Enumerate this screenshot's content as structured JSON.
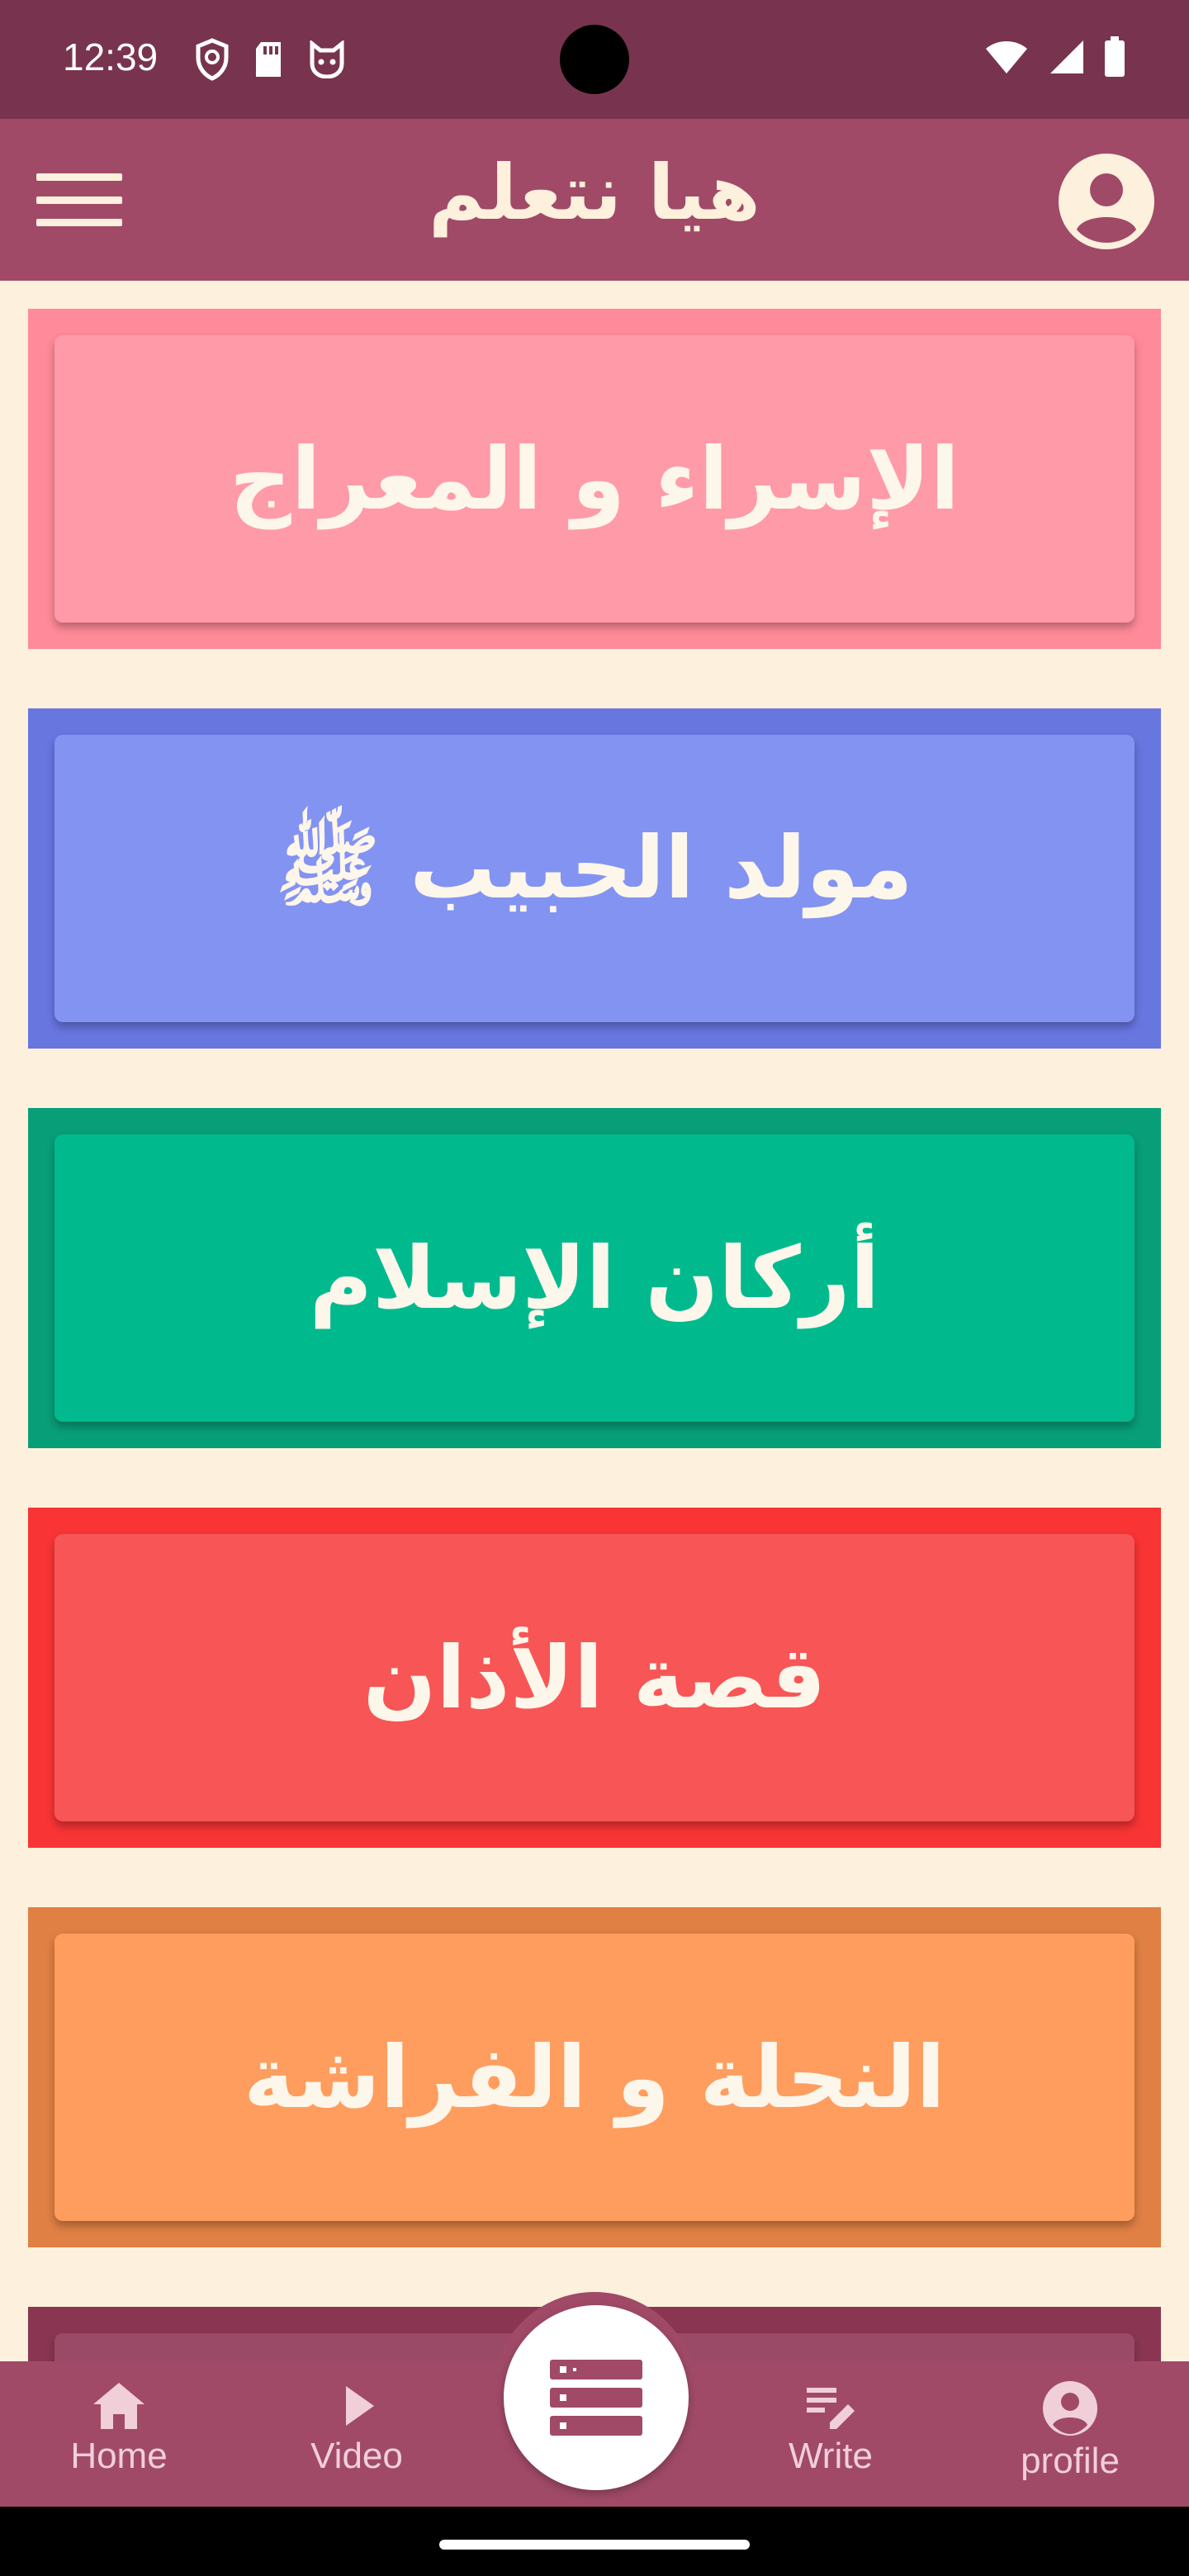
{
  "status_bar": {
    "time": "12:39",
    "left_icons": [
      "shield-icon",
      "sd-card-icon",
      "cat-icon"
    ],
    "right_icons": [
      "wifi-icon",
      "signal-icon",
      "battery-icon"
    ]
  },
  "app_bar": {
    "title": "هيا نتعلم",
    "menu_icon": "hamburger-menu-icon",
    "profile_icon": "account-circle-icon"
  },
  "cards": [
    {
      "label": "الإسراء و المعراج",
      "outer_color": "#ff8a99",
      "inner_color": "#ff9aa8"
    },
    {
      "label": "مولد الحبيب ﷺ",
      "outer_color": "#6876e0",
      "inner_color": "#8393f2"
    },
    {
      "label": "أركان الإسلام",
      "outer_color": "#089e78",
      "inner_color": "#00ba8e"
    },
    {
      "label": "قصة الأذان",
      "outer_color": "#f83434",
      "inner_color": "#f85556"
    },
    {
      "label": "النحلة و الفراشة",
      "outer_color": "#e08044",
      "inner_color": "#ff9d5e"
    },
    {
      "label": "",
      "outer_color": "#8a3652",
      "inner_color": "#9a4a66"
    }
  ],
  "bottom_nav": {
    "items": [
      {
        "label": "Home",
        "icon": "home-icon"
      },
      {
        "label": "Video",
        "icon": "play-icon"
      },
      {
        "label": "Write",
        "icon": "edit-note-icon"
      },
      {
        "label": "profile",
        "icon": "account-circle-icon"
      }
    ],
    "center_fab_icon": "list-icon"
  },
  "colors": {
    "status_bar": "#78344e",
    "app_bar": "#a04a68",
    "background": "#fdf0dc",
    "accent_text": "#fdf0dc"
  }
}
